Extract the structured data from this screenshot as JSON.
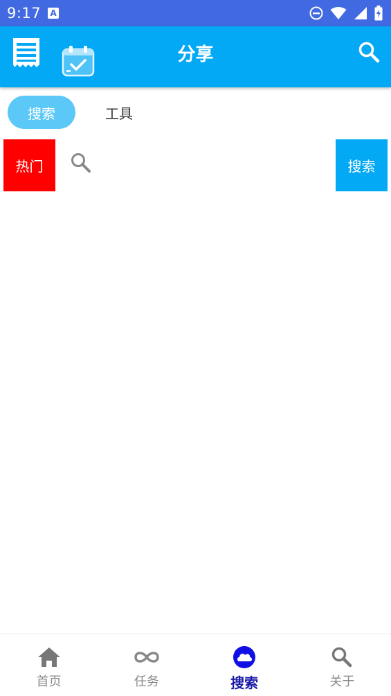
{
  "status_bar": {
    "time": "9:17",
    "notification_letter": "A",
    "icons": [
      "dnd-icon",
      "wifi-icon",
      "signal-icon",
      "battery-charging-icon"
    ]
  },
  "app_bar": {
    "title": "分享",
    "left_icons": [
      "menu-receipt-icon",
      "calendar-check-icon"
    ],
    "right_icon": "search-icon",
    "color": "#03a9f4"
  },
  "tabs": [
    {
      "label": "搜索",
      "active": true
    },
    {
      "label": "工具",
      "active": false
    }
  ],
  "search": {
    "hot_label": "热门",
    "hot_color": "#ff0000",
    "input_value": "",
    "input_placeholder": "",
    "button_label": "搜索",
    "button_color": "#03a9f4"
  },
  "bottom_nav": {
    "items": [
      {
        "label": "首页",
        "icon": "home-icon",
        "active": false
      },
      {
        "label": "任务",
        "icon": "infinity-icon",
        "active": false
      },
      {
        "label": "搜索",
        "icon": "cloud-icon",
        "active": true
      },
      {
        "label": "关于",
        "icon": "search-icon",
        "active": false
      }
    ],
    "active_color": "#1a1aa8",
    "inactive_color": "#8a8a8a"
  }
}
